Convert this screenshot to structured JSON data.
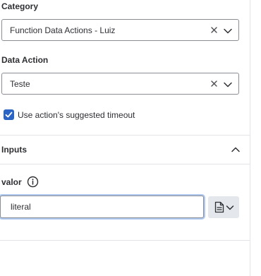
{
  "category": {
    "label": "Category",
    "value": "Function Data Actions - Luiz"
  },
  "data_action": {
    "label": "Data Action",
    "value": "Teste"
  },
  "timeout": {
    "label": "Use action's suggested timeout",
    "checked": true
  },
  "inputs": {
    "title": "Inputs",
    "expanded": true,
    "params": [
      {
        "label": "valor",
        "value": "literal",
        "type_icon": "document-icon"
      }
    ]
  },
  "colors": {
    "accent": "#2a64c5",
    "focus_ring": "#aec8ef",
    "border": "#8a8d94",
    "divider": "#e2e4e8",
    "button_bg": "#e4e7eb"
  }
}
